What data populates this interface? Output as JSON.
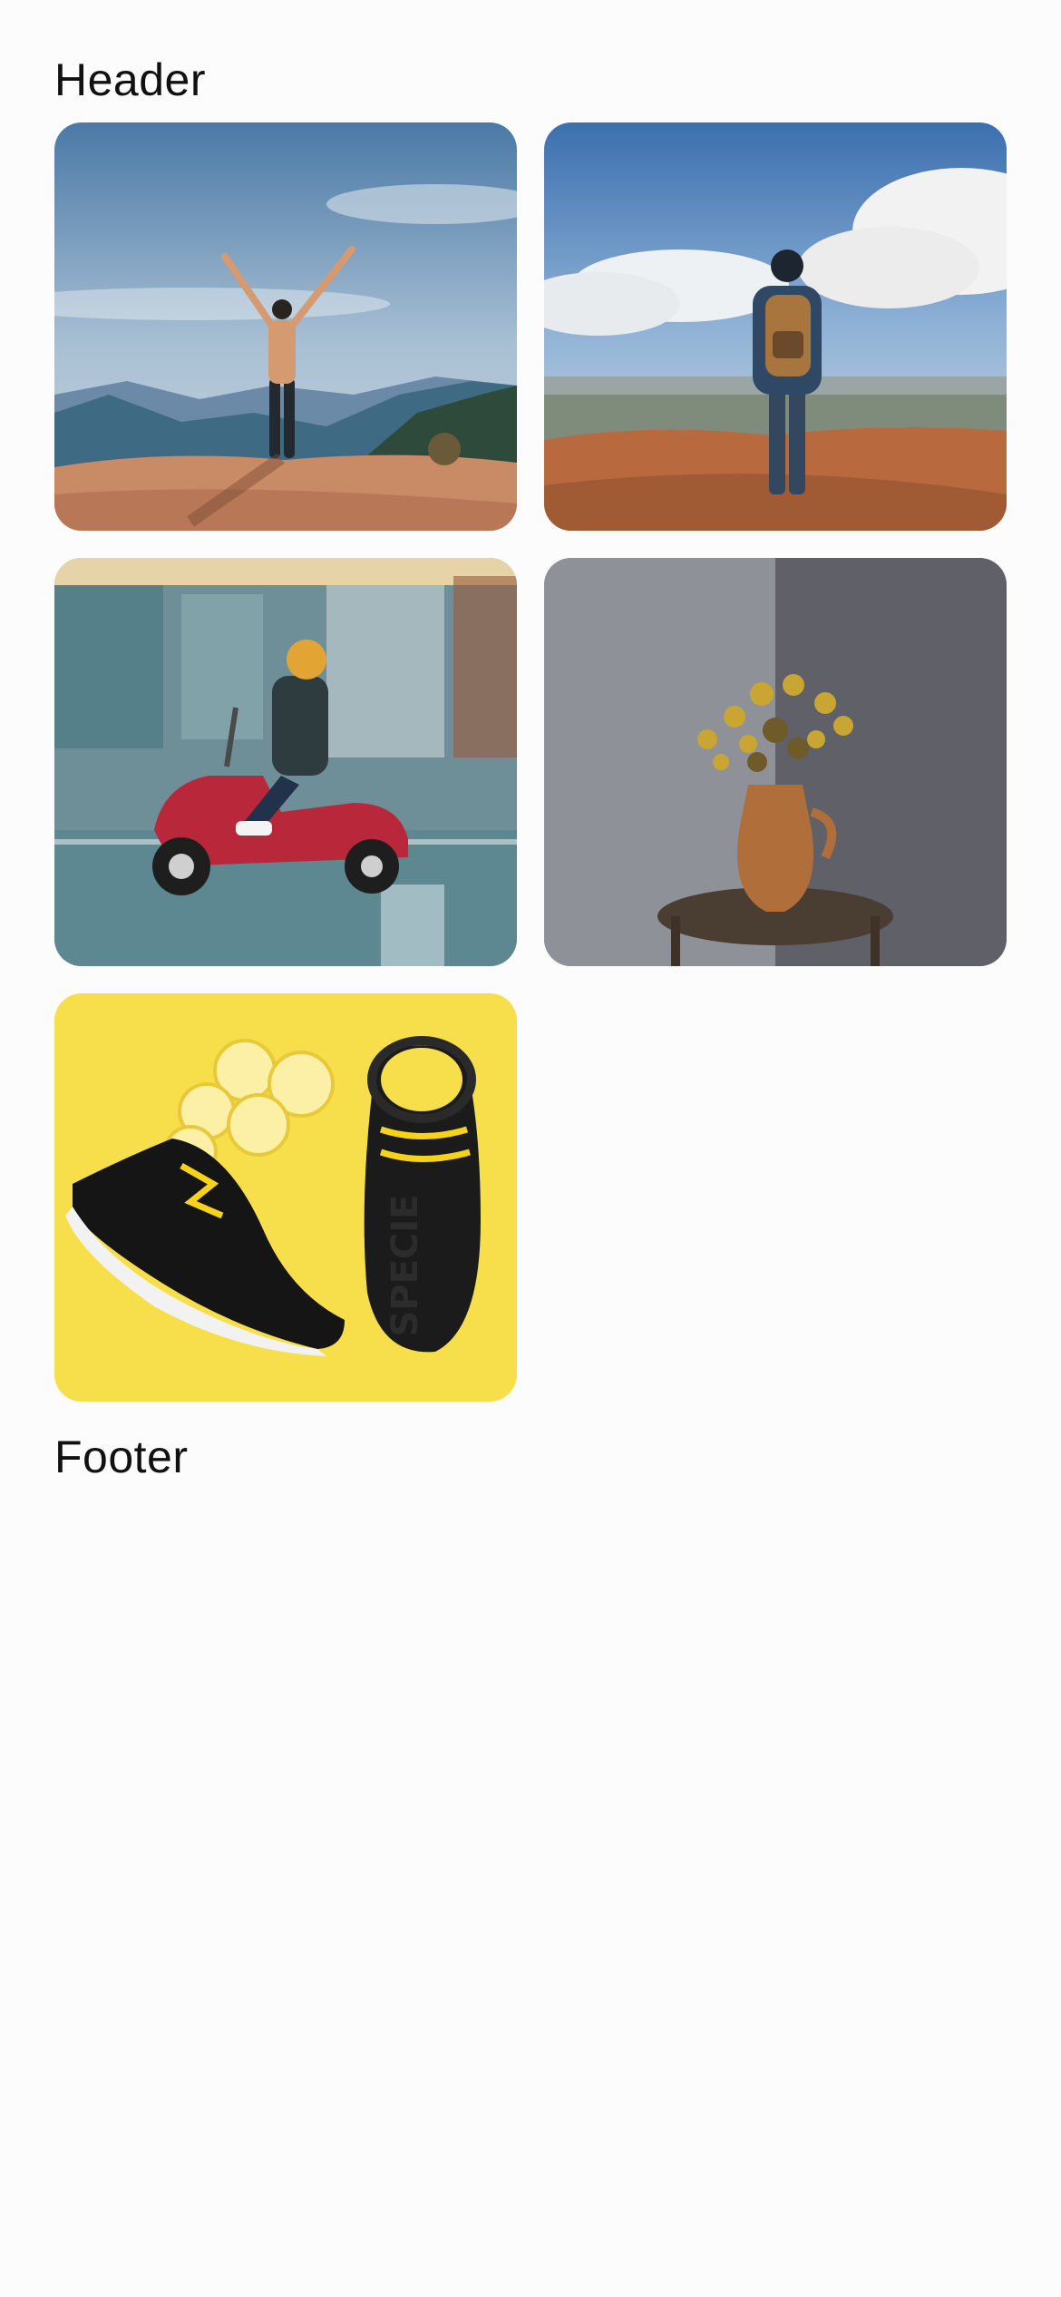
{
  "header": {
    "title": "Header"
  },
  "footer": {
    "title": "Footer"
  },
  "gallery": {
    "photos": [
      {
        "subject": "hiker-arms-raised-on-cliff"
      },
      {
        "subject": "backpacker-overlooking-valley"
      },
      {
        "subject": "rider-on-red-scooter"
      },
      {
        "subject": "dried-flowers-in-clay-jug"
      },
      {
        "subject": "black-sneakers-with-lemons"
      }
    ]
  },
  "colors": {
    "background": "#fdfcfc",
    "text": "#111111",
    "scooter_red": "#b8283a",
    "sneaker_backdrop_yellow": "#f6df4a"
  }
}
